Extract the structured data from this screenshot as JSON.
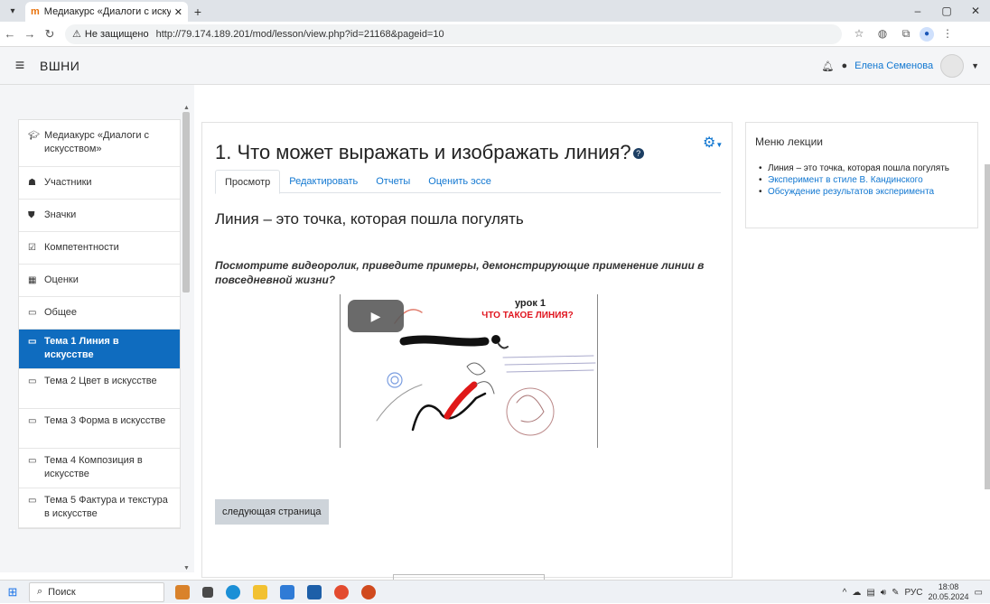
{
  "browser": {
    "tab_title": "Медиакурс «Диалоги с искусс",
    "insecure_label": "Не защищено",
    "url": "http://79.174.189.201/mod/lesson/view.php?id=21168&pageid=10"
  },
  "navbar": {
    "site_name": "ВШНИ",
    "user_name": "Елена Семенова"
  },
  "drawer": {
    "items": [
      {
        "label": "Медиакурс «Диалоги с искусством»",
        "icon": "graduation-cap-icon"
      },
      {
        "label": "Участники",
        "icon": "users-icon"
      },
      {
        "label": "Значки",
        "icon": "shield-icon"
      },
      {
        "label": "Компетентности",
        "icon": "checkbox-icon"
      },
      {
        "label": "Оценки",
        "icon": "table-icon"
      },
      {
        "label": "Общее",
        "icon": "folder-icon"
      },
      {
        "label": "Тема 1 Линия в искусстве",
        "icon": "folder-icon"
      },
      {
        "label": "Тема 2 Цвет в искусстве",
        "icon": "folder-icon"
      },
      {
        "label": "Тема 3 Форма в искусстве",
        "icon": "folder-icon"
      },
      {
        "label": "Тема 4 Композиция в искусстве",
        "icon": "folder-icon"
      },
      {
        "label": "Тема 5 Фактура и текстура в искусстве",
        "icon": "folder-icon"
      }
    ]
  },
  "main": {
    "page_title": "1. Что может выражать и изображать линия?",
    "tabs": [
      "Просмотр",
      "Редактировать",
      "Отчеты",
      "Оценить эссе"
    ],
    "lesson_heading": "Линия – это точка, которая пошла погулять",
    "instruction": "Посмотрите видеоролик, приведите примеры, демонстрирующие применение линии в повседневной жизни?",
    "video_title": "урок 1",
    "video_subtitle": "ЧТО ТАКОЕ ЛИНИЯ?",
    "next_button": "следующая страница"
  },
  "side": {
    "title": "Меню лекции",
    "items": [
      {
        "label": "Линия – это точка, которая пошла погулять",
        "current": true
      },
      {
        "label": "Эксперимент в стиле В. Кандинского",
        "current": false
      },
      {
        "label": "Обсуждение результатов эксперимента",
        "current": false
      }
    ]
  },
  "taskbar": {
    "search_label": "Поиск",
    "lang": "РУС",
    "time": "18:08",
    "date": "20.05.2024"
  },
  "colors": {
    "accent": "#0f6cbf",
    "link": "#1177d1",
    "video_subtitle": "#e0141e"
  }
}
